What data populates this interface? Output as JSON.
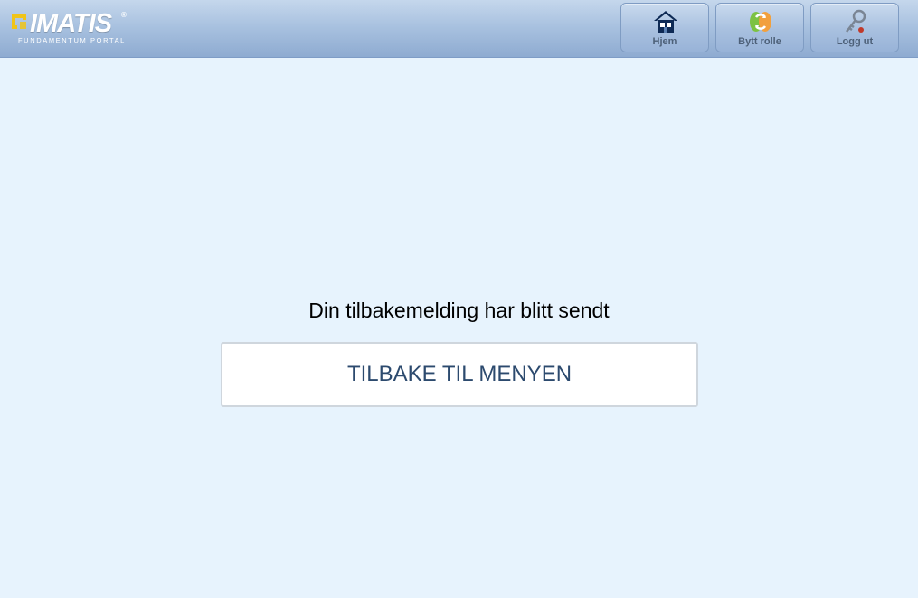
{
  "header": {
    "logo": {
      "name": "IMATIS",
      "registered_mark": "®",
      "subtitle": "FUNDAMENTUM PORTAL"
    },
    "nav": [
      {
        "label": "Hjem",
        "icon": "home-icon"
      },
      {
        "label": "Bytt rolle",
        "icon": "switch-role-icon"
      },
      {
        "label": "Logg ut",
        "icon": "key-icon"
      }
    ]
  },
  "main": {
    "message": "Din tilbakemelding har blitt sendt",
    "back_button_label": "TILBAKE TIL MENYEN"
  },
  "colors": {
    "background": "#e7f3fd",
    "header_top": "#c5d7ec",
    "header_bottom": "#8eabd1",
    "button_text": "#2c4a6e",
    "logo_accent": "#f0c419"
  }
}
